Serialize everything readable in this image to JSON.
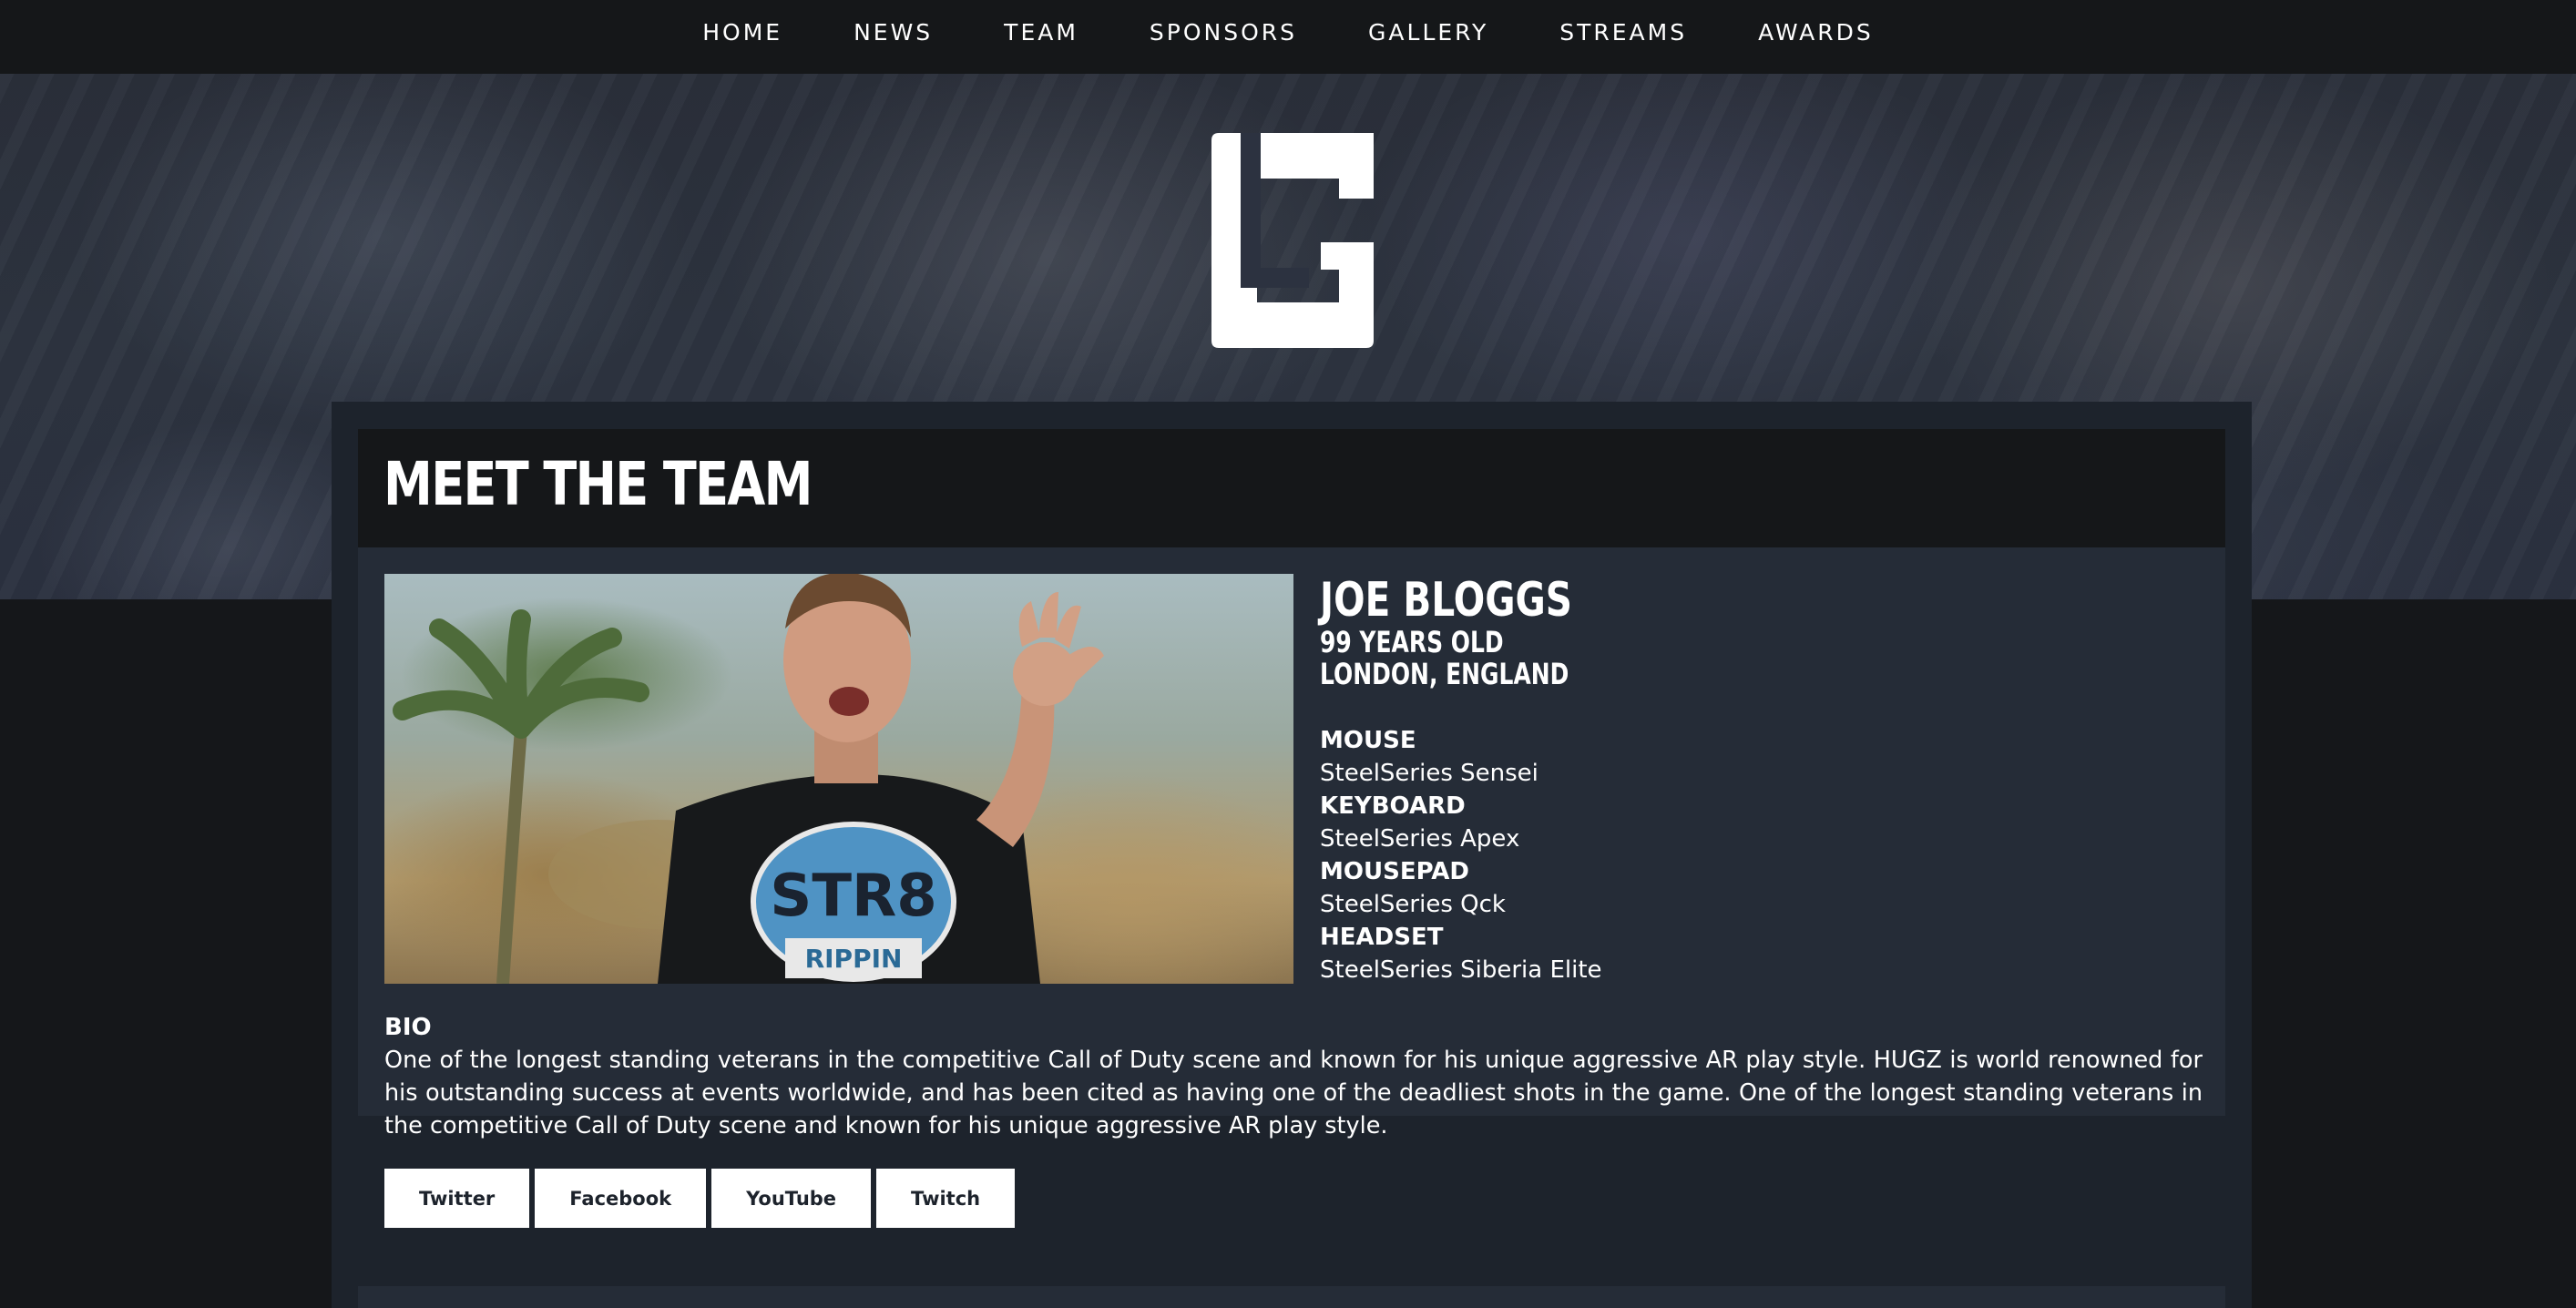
{
  "nav": {
    "items": [
      "HOME",
      "NEWS",
      "TEAM",
      "SPONSORS",
      "GALLERY",
      "STREAMS",
      "AWARDS"
    ]
  },
  "hero": {
    "logo_icon": "team-g-logo"
  },
  "section": {
    "title": "MEET THE TEAM"
  },
  "player": {
    "name": "JOE BLOGGS",
    "age": "99 YEARS OLD",
    "location": "LONDON, ENGLAND",
    "gear": [
      {
        "label": "MOUSE",
        "value": "SteelSeries Sensei"
      },
      {
        "label": "KEYBOARD",
        "value": "SteelSeries Apex"
      },
      {
        "label": "MOUSEPAD",
        "value": "SteelSeries Qck"
      },
      {
        "label": "HEADSET",
        "value": "SteelSeries Siberia Elite"
      }
    ],
    "bio_label": "BIO",
    "bio": "One of the longest standing veterans in the competitive Call of Duty scene and known for his unique aggressive AR play style. HUGZ is world renowned for his outstanding success at events worldwide, and has been cited as having one of the deadliest shots in the game. One of the longest standing veterans in the competitive Call of Duty scene and known for his unique aggressive AR play style.",
    "socials": [
      "Twitter",
      "Facebook",
      "YouTube",
      "Twitch"
    ],
    "photo_shirt": [
      "STR8",
      "RIPPIN"
    ]
  },
  "colors": {
    "nav_bg": "#151719",
    "panel_bg": "#1d232c",
    "card_bg": "#252c37",
    "text": "#ffffff"
  }
}
